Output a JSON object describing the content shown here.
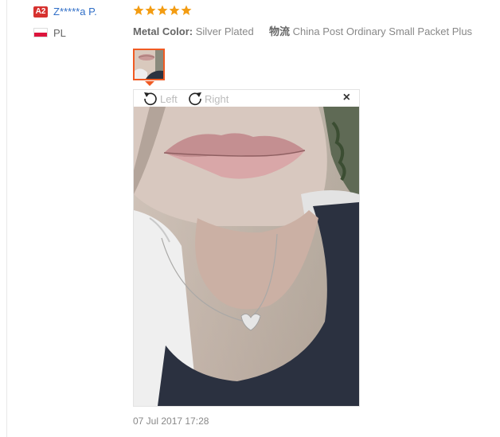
{
  "reviewer": {
    "level_badge": "A2",
    "name": "Z*****a P.",
    "country": "PL",
    "flag_colors": [
      "#ffffff",
      "#dc143c"
    ]
  },
  "review": {
    "rating": 5,
    "attributes": [
      {
        "label": "Metal Color:",
        "value": "Silver Plated"
      },
      {
        "label": "物流",
        "value": "China Post Ordinary Small Packet Plus"
      }
    ],
    "date": "07 Jul 2017 17:28"
  },
  "viewer": {
    "rotate_left_label": "Left",
    "rotate_right_label": "Right",
    "close_symbol": "×"
  },
  "colors": {
    "accent": "#f05a23",
    "star": "#f39c12",
    "link": "#2f6ec7",
    "badge": "#d6312f"
  }
}
